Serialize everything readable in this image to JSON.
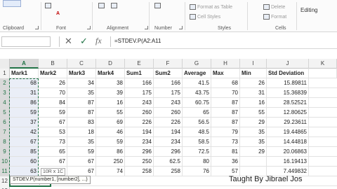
{
  "ribbon": {
    "clipboard_label": "Clipboard",
    "font_label": "Font",
    "alignment_label": "Alignment",
    "number_label": "Number",
    "styles_label": "Styles",
    "cells_label": "Cells",
    "format_as_table": "Format as Table",
    "cell_styles": "Cell Styles",
    "delete": "Delete",
    "format": "Format",
    "editing": "Editing",
    "font_a": "A",
    "align_a": "A"
  },
  "formula_bar": {
    "name_box": "",
    "cancel": "✕",
    "enter": "✓",
    "fx": "fx",
    "formula": "=STDEV.P(A2:A11"
  },
  "columns": [
    "A",
    "B",
    "C",
    "D",
    "E",
    "F",
    "G",
    "H",
    "I",
    "J",
    "K"
  ],
  "header_row": [
    "Mark1",
    "Mark2",
    "Mark3",
    "Mark4",
    "Sum1",
    "Sum2",
    "Average",
    "Max",
    "Min",
    "Std Deviation",
    ""
  ],
  "rows": [
    [
      "68",
      "26",
      "34",
      "38",
      "166",
      "166",
      "41.5",
      "68",
      "26",
      "15.89811"
    ],
    [
      "31",
      "70",
      "35",
      "39",
      "175",
      "175",
      "43.75",
      "70",
      "31",
      "15.36839"
    ],
    [
      "86",
      "84",
      "87",
      "16",
      "243",
      "243",
      "60.75",
      "87",
      "16",
      "28.52521"
    ],
    [
      "59",
      "59",
      "87",
      "55",
      "260",
      "260",
      "65",
      "87",
      "55",
      "12.80625"
    ],
    [
      "37",
      "67",
      "83",
      "69",
      "226",
      "226",
      "56.5",
      "87",
      "29",
      "29.23611"
    ],
    [
      "42",
      "53",
      "18",
      "46",
      "194",
      "194",
      "48.5",
      "79",
      "35",
      "19.44865"
    ],
    [
      "67",
      "73",
      "35",
      "59",
      "234",
      "234",
      "58.5",
      "73",
      "35",
      "14.44818"
    ],
    [
      "85",
      "65",
      "59",
      "86",
      "296",
      "296",
      "72.5",
      "81",
      "29",
      "20.06863"
    ],
    [
      "60",
      "67",
      "67",
      "250",
      "250",
      "62.5",
      "80",
      "36",
      "",
      "16.19413"
    ],
    [
      "63",
      "72",
      "67",
      "74",
      "258",
      "258",
      "76",
      "57",
      "",
      "7.449832"
    ]
  ],
  "row_numbers": [
    "1",
    "2",
    "3",
    "4",
    "5",
    "6",
    "7",
    "8",
    "9",
    "10",
    "11",
    "12",
    "13"
  ],
  "active_cell_text": "=STDEV.P(",
  "tooltip": "STDEV.P(number1, [number2], ...)",
  "size_hint": "10R x 1C",
  "watermark": "Taught By Jibrael Jos"
}
